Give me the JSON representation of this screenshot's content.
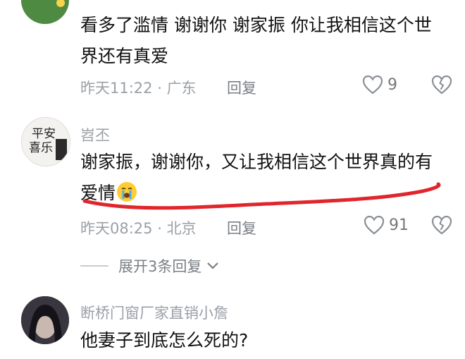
{
  "comments": [
    {
      "username": "",
      "text": "看多了滥情 谢谢你 谢家振 你让我相信这个世界还有真爱",
      "time": "昨天11:22",
      "location": "广东",
      "reply_label": "回复",
      "likes": "9"
    },
    {
      "username": "岧丕",
      "text_before_emoji": "谢家振，谢谢你，又让我相信这个世界真的有爱情",
      "emoji": "crying-face",
      "time": "昨天08:25",
      "location": "北京",
      "reply_label": "回复",
      "likes": "91",
      "expand_replies": "展开3条回复"
    },
    {
      "username": "断桥门窗厂家直销小詹",
      "text": "他妻子到底怎么死的?"
    }
  ],
  "separator": " · ",
  "colors": {
    "annotation": "#e0262d",
    "secondary_text": "#9aa0a6"
  }
}
